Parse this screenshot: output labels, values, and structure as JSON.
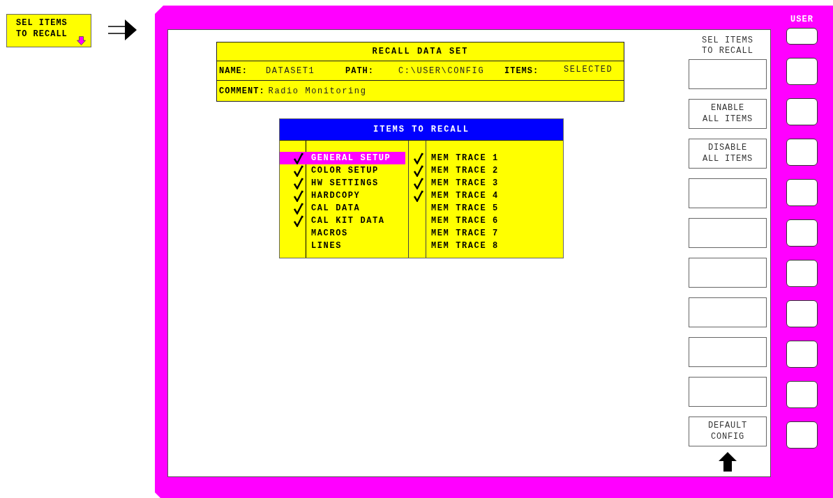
{
  "hint_key": {
    "label": "SEL ITEMS\nTO RECALL"
  },
  "dataset": {
    "title": "RECALL DATA SET",
    "fields": [
      {
        "label": "NAME:",
        "value": "DATASET1"
      },
      {
        "label": "PATH:",
        "value": "C:\\USER\\CONFIG"
      },
      {
        "label": "ITEMS:",
        "value": "SELECTED"
      }
    ],
    "comment": {
      "label": "COMMENT:",
      "value": "Radio Monitoring"
    }
  },
  "items_dialog": {
    "title": "ITEMS TO RECALL",
    "left_items": [
      {
        "label": "GENERAL SETUP",
        "checked": true,
        "selected": true
      },
      {
        "label": "COLOR SETUP",
        "checked": true,
        "selected": false
      },
      {
        "label": "HW SETTINGS",
        "checked": true,
        "selected": false
      },
      {
        "label": "HARDCOPY",
        "checked": true,
        "selected": false
      },
      {
        "label": "CAL DATA",
        "checked": true,
        "selected": false
      },
      {
        "label": "CAL KIT DATA",
        "checked": true,
        "selected": false
      },
      {
        "label": "MACROS",
        "checked": false,
        "selected": false
      },
      {
        "label": "LINES",
        "checked": false,
        "selected": false
      }
    ],
    "right_items": [
      {
        "label": "MEM TRACE 1",
        "checked": true,
        "selected": false
      },
      {
        "label": "MEM TRACE 2",
        "checked": true,
        "selected": false
      },
      {
        "label": "MEM TRACE 3",
        "checked": true,
        "selected": false
      },
      {
        "label": "MEM TRACE 4",
        "checked": true,
        "selected": false
      },
      {
        "label": "MEM TRACE 5",
        "checked": false,
        "selected": false
      },
      {
        "label": "MEM TRACE 6",
        "checked": false,
        "selected": false
      },
      {
        "label": "MEM TRACE 7",
        "checked": false,
        "selected": false
      },
      {
        "label": "MEM TRACE 8",
        "checked": false,
        "selected": false
      }
    ]
  },
  "softkey_menu": {
    "title": "SEL ITEMS\nTO RECALL",
    "softkeys": [
      {
        "kind": "blank"
      },
      {
        "kind": "labeled",
        "label": "ENABLE\nALL ITEMS"
      },
      {
        "kind": "labeled",
        "label": "DISABLE\nALL ITEMS"
      },
      {
        "kind": "blank"
      },
      {
        "kind": "blank"
      },
      {
        "kind": "blank"
      },
      {
        "kind": "blank"
      },
      {
        "kind": "blank"
      },
      {
        "kind": "blank"
      },
      {
        "kind": "labeled",
        "label": "DEFAULT\nCONFIG"
      }
    ]
  },
  "hardkey_panel": {
    "label": "USER"
  }
}
